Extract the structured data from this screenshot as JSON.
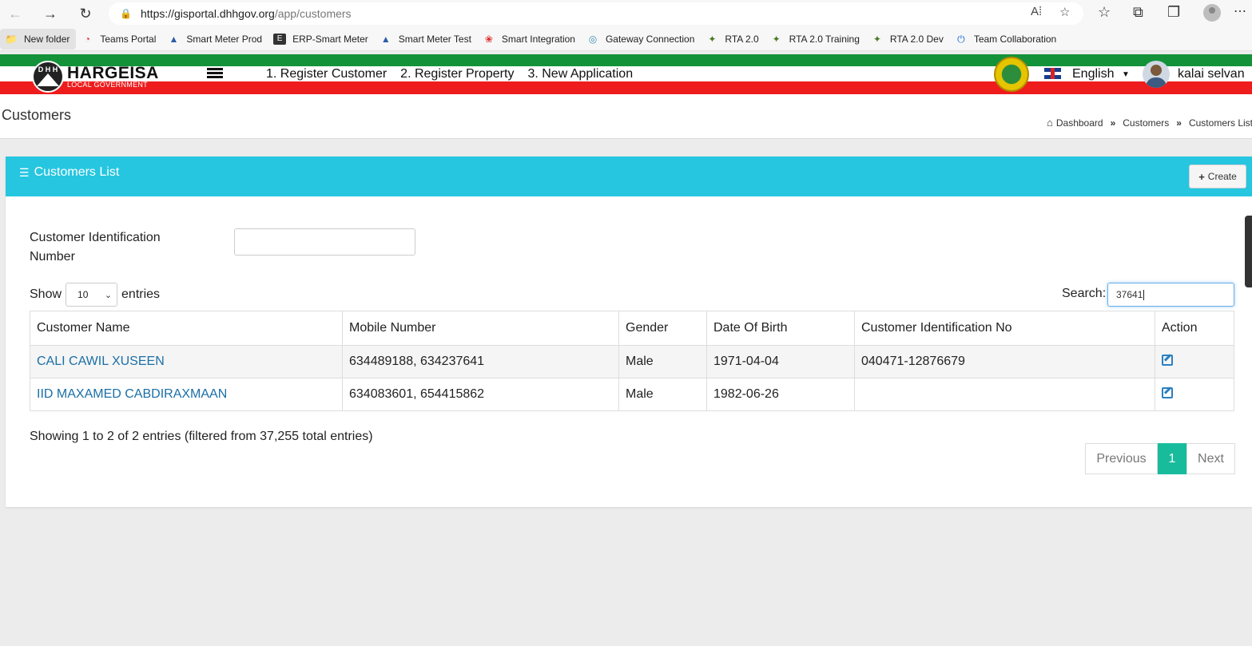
{
  "browser": {
    "url_host": "https://gisportal.dhhgov.org",
    "url_path": "/app/customers",
    "bookmarks": [
      {
        "label": "New folder",
        "icon": "folder-icon"
      },
      {
        "label": "Teams Portal",
        "icon": "gauge-icon"
      },
      {
        "label": "Smart Meter Prod",
        "icon": "drop-icon"
      },
      {
        "label": "ERP-Smart Meter",
        "icon": "e-icon"
      },
      {
        "label": "Smart Meter Test",
        "icon": "drop-icon"
      },
      {
        "label": "Smart Integration",
        "icon": "flower-icon"
      },
      {
        "label": "Gateway Connection",
        "icon": "globe-icon"
      },
      {
        "label": "RTA 2.0",
        "icon": "emblem-icon"
      },
      {
        "label": "RTA 2.0 Training",
        "icon": "emblem-icon"
      },
      {
        "label": "RTA 2.0 Dev",
        "icon": "emblem-icon"
      },
      {
        "label": "Team Collaboration",
        "icon": "power-icon"
      }
    ]
  },
  "header": {
    "logo_title": "HARGEISA",
    "logo_subtitle": "LOCAL GOVERNMENT",
    "logo_initials": "D H H",
    "nav": [
      "1. Register Customer",
      "2. Register Property",
      "3. New Application"
    ],
    "language": "English",
    "user_name": "kalai selvan"
  },
  "page": {
    "title": "Customers",
    "breadcrumb": [
      "Dashboard",
      "Customers",
      "Customers List"
    ]
  },
  "card": {
    "title": "Customers List",
    "create_label": "Create",
    "filter_label": "Customer Identification Number",
    "filter_value": "",
    "show_label": "Show",
    "show_value": "10",
    "entries_label": "entries",
    "search_label": "Search:",
    "search_value": "37641",
    "columns": [
      "Customer Name",
      "Mobile Number",
      "Gender",
      "Date Of Birth",
      "Customer Identification No",
      "Action"
    ],
    "rows": [
      {
        "name": "CALI CAWIL XUSEEN",
        "mobile": "634489188, 634237641",
        "gender": "Male",
        "dob": "1971-04-04",
        "cid": "040471-12876679"
      },
      {
        "name": "IID MAXAMED CABDIRAXMAAN",
        "mobile": "634083601, 654415862",
        "gender": "Male",
        "dob": "1982-06-26",
        "cid": ""
      }
    ],
    "info": "Showing 1 to 2 of 2 entries (filtered from 37,255 total entries)",
    "pagination": {
      "previous": "Previous",
      "current": "1",
      "next": "Next"
    }
  },
  "colors": {
    "header_green": "#14923a",
    "header_red": "#ee1c1c",
    "card_header": "#26c6e0",
    "pager_active": "#18bc9c",
    "link": "#1a6fa6"
  }
}
